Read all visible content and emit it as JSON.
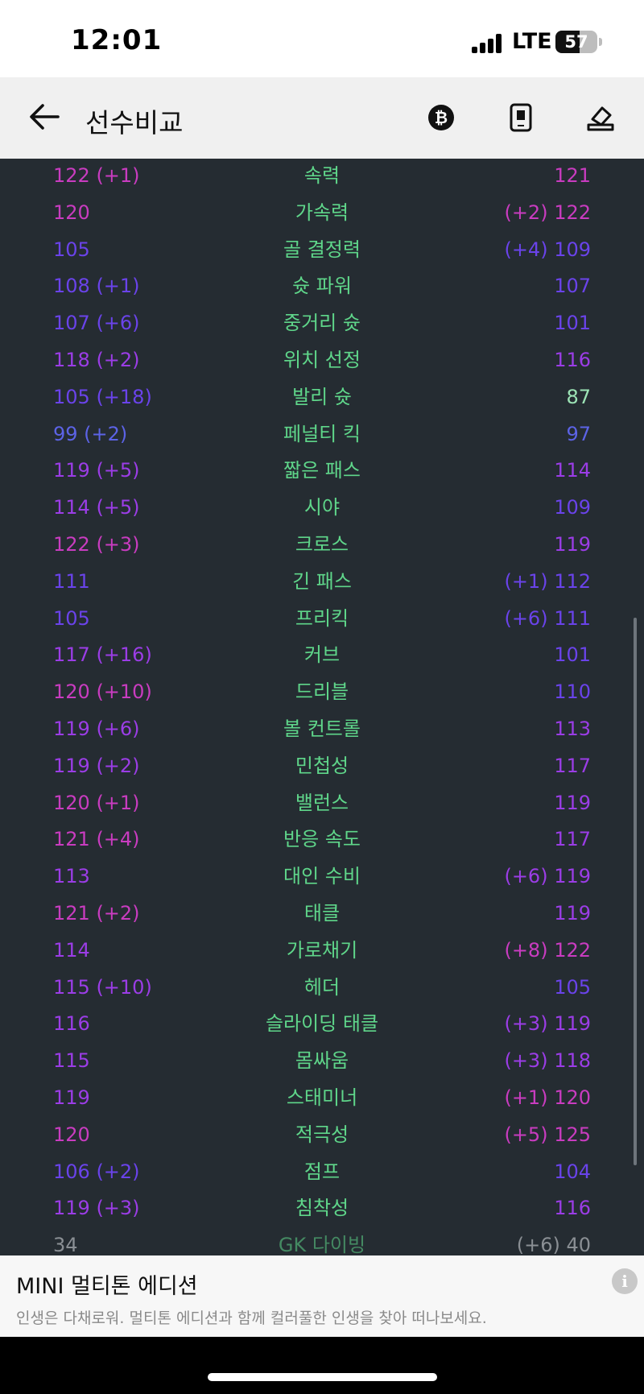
{
  "status_bar": {
    "time": "12:01",
    "network": "LTE",
    "battery": "57",
    "battery_level": 0.57
  },
  "header": {
    "title": "선수비교"
  },
  "icons": {
    "back": "arrow-left-icon",
    "coin": "bitcoin-icon",
    "phone": "phone-screen-icon",
    "eraser": "eraser-icon",
    "info": "info-icon"
  },
  "colors": {
    "background": "#252c32",
    "stat_name": "#5fd68a",
    "tier_pink": "#c93cc0",
    "tier_purple": "#9b3de6",
    "tier_violet": "#6a43ea",
    "tier_blue": "#5c63e6",
    "tier_low": "#9ce3b5"
  },
  "stats": [
    {
      "left": "122 (+1)",
      "name": "속력",
      "right": "121",
      "lc": "#c93cc0",
      "rc": "#c93cc0"
    },
    {
      "left": "120",
      "name": "가속력",
      "right": "(+2) 122",
      "lc": "#c93cc0",
      "rc": "#c93cc0"
    },
    {
      "left": "105",
      "name": "골 결정력",
      "right": "(+4) 109",
      "lc": "#6a43ea",
      "rc": "#6a43ea"
    },
    {
      "left": "108 (+1)",
      "name": "슛 파워",
      "right": "107",
      "lc": "#6a43ea",
      "rc": "#6a43ea"
    },
    {
      "left": "107 (+6)",
      "name": "중거리 슛",
      "right": "101",
      "lc": "#6a43ea",
      "rc": "#6a43ea"
    },
    {
      "left": "118 (+2)",
      "name": "위치 선정",
      "right": "116",
      "lc": "#9b3de6",
      "rc": "#9b3de6"
    },
    {
      "left": "105 (+18)",
      "name": "발리 슛",
      "right": "87",
      "lc": "#6a43ea",
      "rc": "#9ce3b5"
    },
    {
      "left": "99 (+2)",
      "name": "페널티 킥",
      "right": "97",
      "lc": "#5c63e6",
      "rc": "#5c63e6"
    },
    {
      "left": "119 (+5)",
      "name": "짧은 패스",
      "right": "114",
      "lc": "#9b3de6",
      "rc": "#9b3de6"
    },
    {
      "left": "114 (+5)",
      "name": "시야",
      "right": "109",
      "lc": "#9b3de6",
      "rc": "#6a43ea"
    },
    {
      "left": "122 (+3)",
      "name": "크로스",
      "right": "119",
      "lc": "#c93cc0",
      "rc": "#9b3de6"
    },
    {
      "left": "111",
      "name": "긴 패스",
      "right": "(+1) 112",
      "lc": "#6a43ea",
      "rc": "#6a43ea"
    },
    {
      "left": "105",
      "name": "프리킥",
      "right": "(+6) 111",
      "lc": "#6a43ea",
      "rc": "#6a43ea"
    },
    {
      "left": "117 (+16)",
      "name": "커브",
      "right": "101",
      "lc": "#9b3de6",
      "rc": "#6a43ea"
    },
    {
      "left": "120 (+10)",
      "name": "드리블",
      "right": "110",
      "lc": "#c93cc0",
      "rc": "#6a43ea"
    },
    {
      "left": "119 (+6)",
      "name": "볼 컨트롤",
      "right": "113",
      "lc": "#9b3de6",
      "rc": "#9b3de6"
    },
    {
      "left": "119 (+2)",
      "name": "민첩성",
      "right": "117",
      "lc": "#9b3de6",
      "rc": "#9b3de6"
    },
    {
      "left": "120 (+1)",
      "name": "밸런스",
      "right": "119",
      "lc": "#c93cc0",
      "rc": "#9b3de6"
    },
    {
      "left": "121 (+4)",
      "name": "반응 속도",
      "right": "117",
      "lc": "#c93cc0",
      "rc": "#9b3de6"
    },
    {
      "left": "113",
      "name": "대인 수비",
      "right": "(+6) 119",
      "lc": "#9b3de6",
      "rc": "#9b3de6"
    },
    {
      "left": "121 (+2)",
      "name": "태클",
      "right": "119",
      "lc": "#c93cc0",
      "rc": "#9b3de6"
    },
    {
      "left": "114",
      "name": "가로채기",
      "right": "(+8) 122",
      "lc": "#9b3de6",
      "rc": "#c93cc0"
    },
    {
      "left": "115 (+10)",
      "name": "헤더",
      "right": "105",
      "lc": "#9b3de6",
      "rc": "#6a43ea"
    },
    {
      "left": "116",
      "name": "슬라이딩 태클",
      "right": "(+3) 119",
      "lc": "#9b3de6",
      "rc": "#9b3de6"
    },
    {
      "left": "115",
      "name": "몸싸움",
      "right": "(+3) 118",
      "lc": "#9b3de6",
      "rc": "#9b3de6"
    },
    {
      "left": "119",
      "name": "스태미너",
      "right": "(+1) 120",
      "lc": "#9b3de6",
      "rc": "#c93cc0"
    },
    {
      "left": "120",
      "name": "적극성",
      "right": "(+5) 125",
      "lc": "#c93cc0",
      "rc": "#c93cc0"
    },
    {
      "left": "106 (+2)",
      "name": "점프",
      "right": "104",
      "lc": "#6a43ea",
      "rc": "#6a43ea"
    },
    {
      "left": "119 (+3)",
      "name": "침착성",
      "right": "116",
      "lc": "#9b3de6",
      "rc": "#9b3de6"
    },
    {
      "left": "34",
      "name": "GK 다이빙",
      "right": "(+6) 40",
      "lc": "#8a8f94",
      "rc": "#8a8f94"
    }
  ],
  "ad": {
    "title": "MINI 멀티톤 에디션",
    "description": "인생은 다채로워. 멀티톤 에디션과 함께 컬러풀한 인생을 찾아 떠나보세요.",
    "info_label": "i"
  }
}
